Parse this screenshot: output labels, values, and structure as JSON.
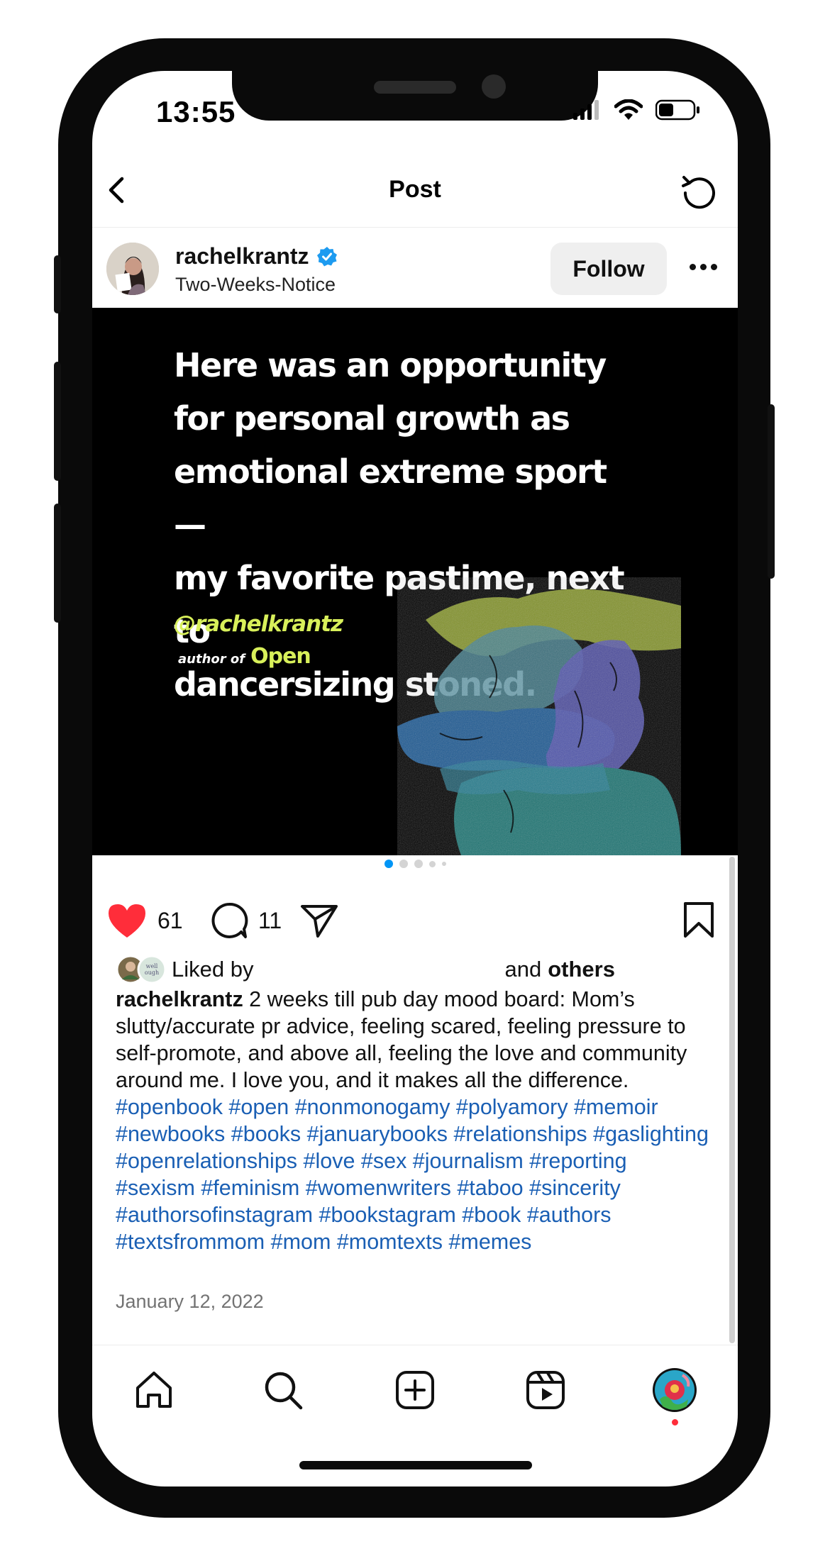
{
  "status": {
    "time": "13:55"
  },
  "nav": {
    "title": "Post"
  },
  "post": {
    "username": "rachelkrantz",
    "subtitle": "Two-Weeks-Notice",
    "follow_label": "Follow",
    "image": {
      "quote": "Here was an opportunity\nfor personal growth as\nemotional extreme sport —\nmy favorite pastime, next to\ndancersizing stoned.",
      "handle": "@rachelkrantz",
      "author_of": "author of",
      "book": "Open"
    },
    "carousel": {
      "count": 5,
      "active_index": 1
    },
    "likes": "61",
    "comments": "11",
    "liked_by": {
      "prefix": "Liked by",
      "middle": "and",
      "others": "others"
    },
    "caption": {
      "username": "rachelkrantz",
      "text": " 2 weeks till pub day mood board: Mom’s slutty/accurate pr advice, feeling scared, feeling pressure to self-promote, and above all, feeling the love and community around me. I love you, and it makes all the difference. ",
      "hashtags": "#openbook #open #nonmonogamy #polyamory #memoir #newbooks #books #januarybooks #relationships #gaslighting #openrelationships #love #sex #journalism #reporting #sexism #feminism #womenwriters #taboo #sincerity #authorsofinstagram #bookstagram #book #authors #textsfrommom #mom #momtexts #memes"
    },
    "date": "January 12, 2022"
  },
  "colors": {
    "like_red": "#ff2d3a",
    "hashtag_blue": "#1a5fb4",
    "verified_blue": "#1d9bf0",
    "dot_active": "#0095f6"
  }
}
